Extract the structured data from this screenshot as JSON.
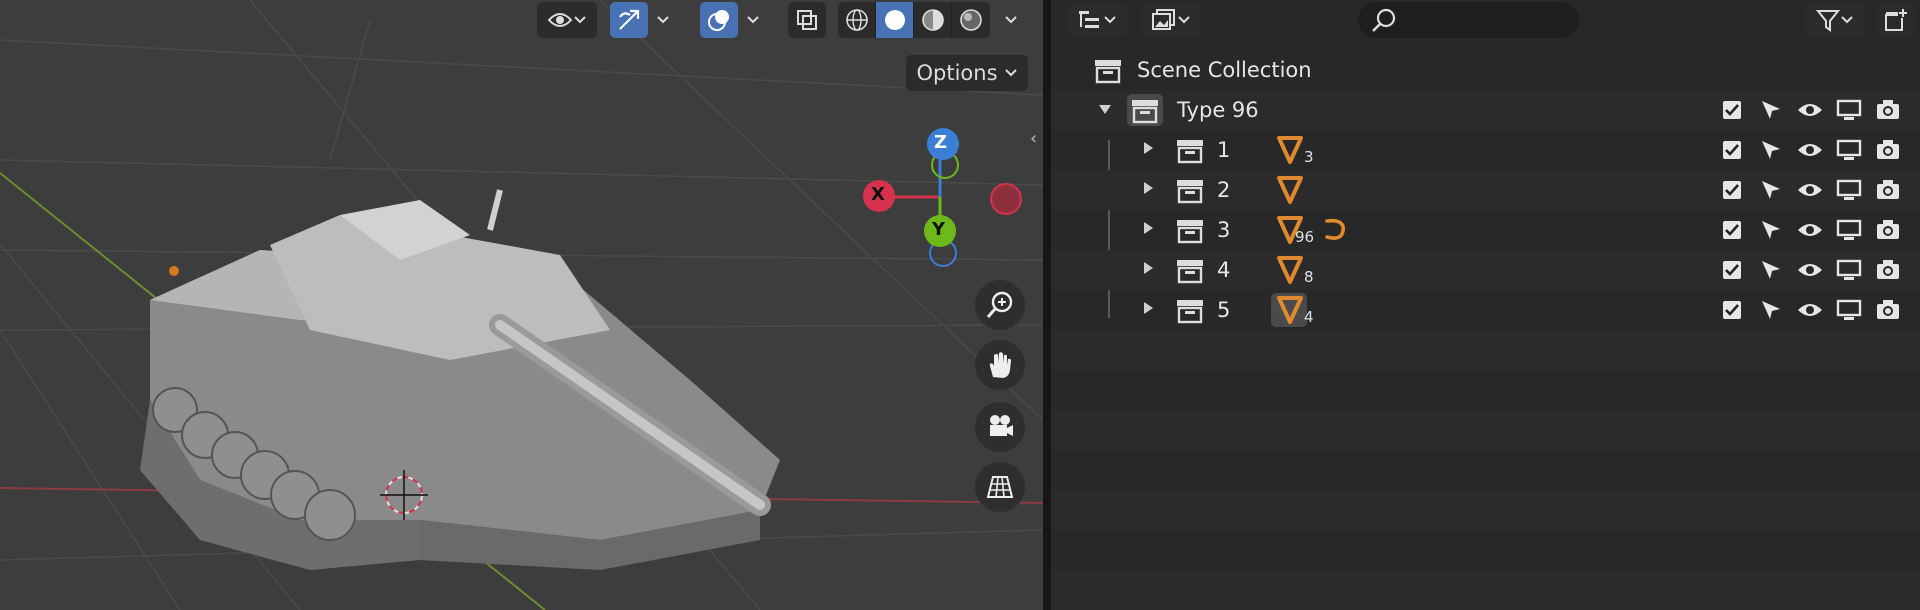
{
  "viewport": {
    "header_icons": [
      "eye-icon",
      "gizmo-icon",
      "overlay-icon",
      "xray-icon"
    ],
    "shading_modes": [
      "wireframe",
      "solid",
      "material-preview",
      "rendered"
    ],
    "options_label": "Options",
    "gizmo": {
      "z": "Z",
      "x": "X",
      "y": "Y"
    },
    "nav_tools": [
      "zoom-icon",
      "pan-hand-icon",
      "camera-icon",
      "perspective-grid-icon"
    ]
  },
  "outliner": {
    "search": {
      "placeholder": ""
    },
    "scene_collection_label": "Scene Collection",
    "collection": {
      "name": "Type 96",
      "children": [
        {
          "name": "1",
          "count": "3"
        },
        {
          "name": "2",
          "count": ""
        },
        {
          "name": "3",
          "count": "96"
        },
        {
          "name": "4",
          "count": "8"
        },
        {
          "name": "5",
          "count": "4"
        }
      ]
    }
  },
  "colors": {
    "accent": "#4772b3",
    "mesh_orange": "#e0892f",
    "axis_x": "#d5334b",
    "axis_y": "#6cba1a",
    "axis_z": "#3a7fd5"
  }
}
